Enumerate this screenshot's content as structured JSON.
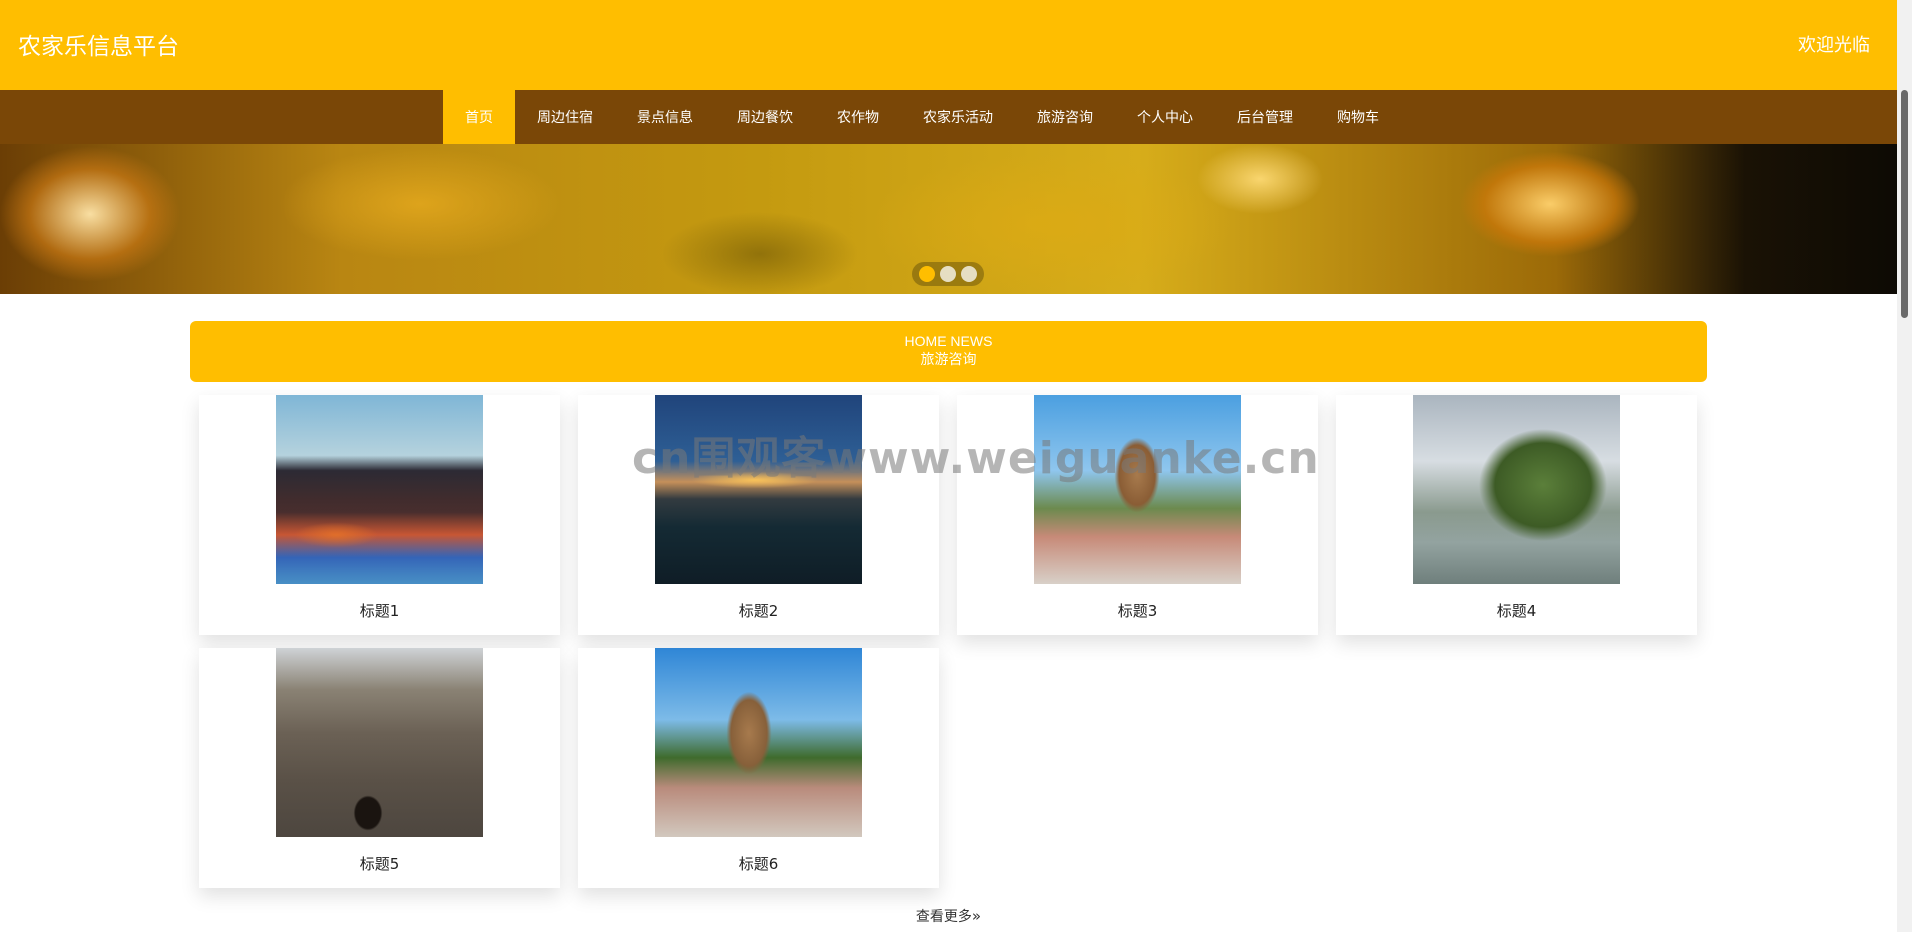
{
  "header": {
    "site_title": "农家乐信息平台",
    "welcome": "欢迎光临"
  },
  "nav": {
    "items": [
      {
        "label": "首页",
        "active": true
      },
      {
        "label": "周边住宿",
        "active": false
      },
      {
        "label": "景点信息",
        "active": false
      },
      {
        "label": "周边餐饮",
        "active": false
      },
      {
        "label": "农作物",
        "active": false
      },
      {
        "label": "农家乐活动",
        "active": false
      },
      {
        "label": "旅游咨询",
        "active": false
      },
      {
        "label": "个人中心",
        "active": false
      },
      {
        "label": "后台管理",
        "active": false
      },
      {
        "label": "购物车",
        "active": false
      }
    ]
  },
  "banner": {
    "dots": 3,
    "active_dot": 0
  },
  "section": {
    "title_en": "HOME NEWS",
    "title_cn": "旅游咨询"
  },
  "cards": [
    {
      "title": "标题1"
    },
    {
      "title": "标题2"
    },
    {
      "title": "标题3"
    },
    {
      "title": "标题4"
    },
    {
      "title": "标题5"
    },
    {
      "title": "标题6"
    }
  ],
  "view_more": "查看更多",
  "watermark": "cn围观客www.weiguanke.cn",
  "colors": {
    "primary_yellow": "#ffbe00",
    "nav_brown": "#7a4707"
  }
}
